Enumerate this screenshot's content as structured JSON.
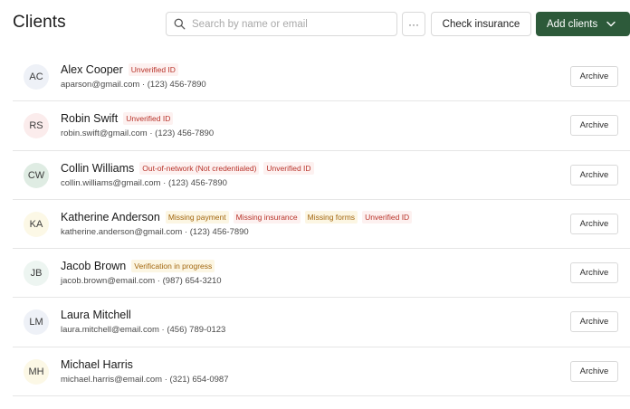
{
  "header": {
    "title": "Clients",
    "search_placeholder": "Search by name or email",
    "more_label": "···",
    "check_insurance_label": "Check insurance",
    "add_clients_label": "Add clients"
  },
  "colors": {
    "primary": "#2d5a3a",
    "badge_red_bg": "#fdf1f0",
    "badge_red_text": "#b8332a",
    "badge_yellow_bg": "#fcf6e3",
    "badge_yellow_text": "#a2660e"
  },
  "clients": [
    {
      "initials": "AC",
      "avatar_color": "#eef1f7",
      "name": "Alex Cooper",
      "email": "aparson@gmail.com",
      "phone": "(123) 456-7890",
      "badges": [
        {
          "label": "Unverified ID",
          "tone": "red"
        }
      ],
      "action": "Archive"
    },
    {
      "initials": "RS",
      "avatar_color": "#fbecec",
      "name": "Robin Swift",
      "email": "robin.swift@gmail.com",
      "phone": "(123) 456-7890",
      "badges": [
        {
          "label": "Unverified ID",
          "tone": "red"
        }
      ],
      "action": "Archive"
    },
    {
      "initials": "CW",
      "avatar_color": "#dfece3",
      "name": "Collin Williams",
      "email": "collin.williams@gmail.com",
      "phone": "(123) 456-7890",
      "badges": [
        {
          "label": "Out-of-network (Not credentialed)",
          "tone": "red"
        },
        {
          "label": "Unverified ID",
          "tone": "red"
        }
      ],
      "action": "Archive"
    },
    {
      "initials": "KA",
      "avatar_color": "#fcf8e6",
      "name": "Katherine Anderson",
      "email": "katherine.anderson@gmail.com",
      "phone": "(123) 456-7890",
      "badges": [
        {
          "label": "Missing payment",
          "tone": "yellow"
        },
        {
          "label": "Missing insurance",
          "tone": "red"
        },
        {
          "label": "Missing forms",
          "tone": "yellow"
        },
        {
          "label": "Unverified ID",
          "tone": "red"
        }
      ],
      "action": "Archive"
    },
    {
      "initials": "JB",
      "avatar_color": "#edf5f1",
      "name": "Jacob Brown",
      "email": "jacob.brown@email.com",
      "phone": "(987) 654-3210",
      "badges": [
        {
          "label": "Verification in progress",
          "tone": "yellow"
        }
      ],
      "action": "Archive"
    },
    {
      "initials": "LM",
      "avatar_color": "#eef1f7",
      "name": "Laura Mitchell",
      "email": "laura.mitchell@email.com",
      "phone": "(456) 789-0123",
      "badges": [],
      "action": "Archive"
    },
    {
      "initials": "MH",
      "avatar_color": "#fcf8e6",
      "name": "Michael Harris",
      "email": "michael.harris@email.com",
      "phone": "(321) 654-0987",
      "badges": [],
      "action": "Archive"
    }
  ]
}
